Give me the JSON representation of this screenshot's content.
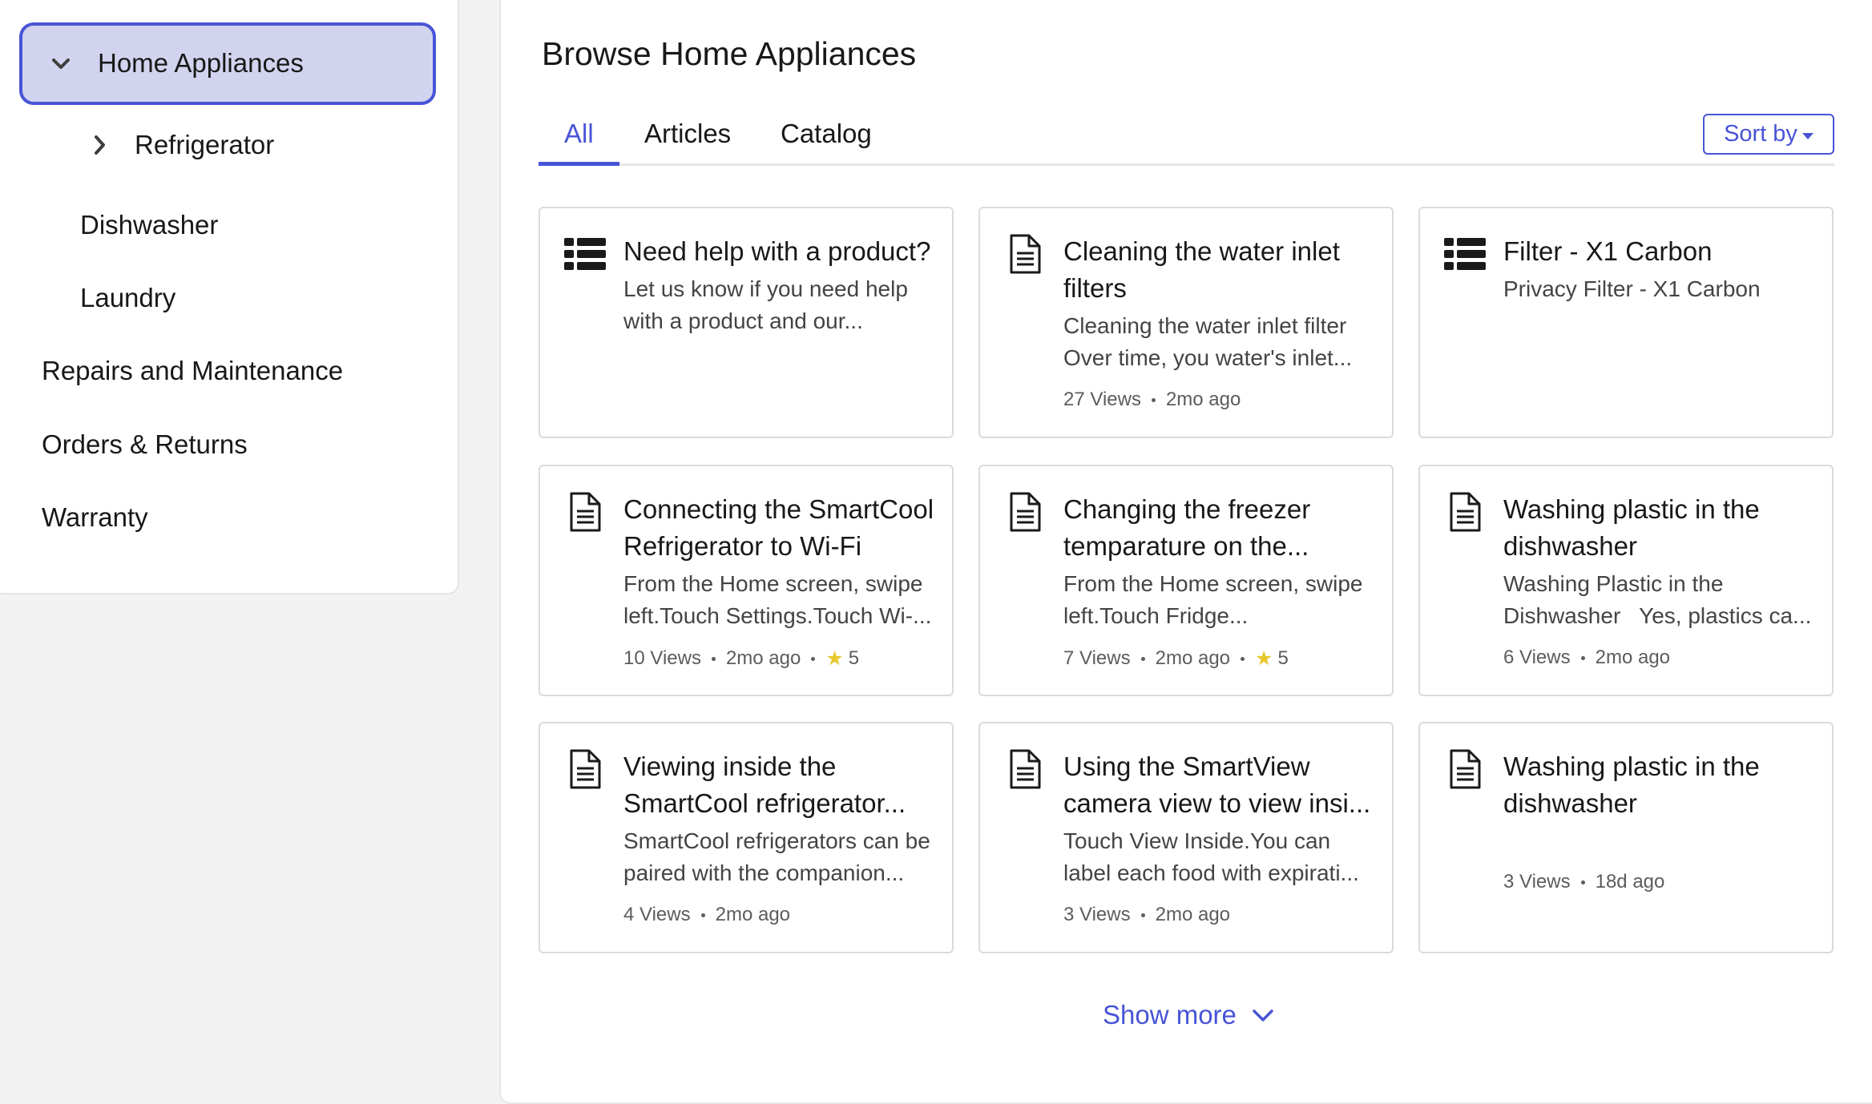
{
  "sidebar": {
    "items": [
      {
        "label": "Home Appliances"
      },
      {
        "label": "Refrigerator"
      },
      {
        "label": "Dishwasher"
      },
      {
        "label": "Laundry"
      },
      {
        "label": "Repairs and Maintenance"
      },
      {
        "label": "Orders & Returns"
      },
      {
        "label": "Warranty"
      }
    ]
  },
  "main": {
    "title": "Browse Home Appliances",
    "tabs": [
      {
        "label": "All",
        "active": true
      },
      {
        "label": "Articles"
      },
      {
        "label": "Catalog"
      }
    ],
    "sort_label": "Sort by",
    "show_more_label": "Show more",
    "cards": [
      {
        "icon": "list-icon",
        "title": "Need help with a product?",
        "description": "Let us know if you need help with a product and our...",
        "views": "",
        "age": "",
        "rating": ""
      },
      {
        "icon": "document-icon",
        "title": "Cleaning the water inlet filters",
        "description": "Cleaning the water inlet filter Over time, you water's inlet...",
        "views": "27 Views",
        "age": "2mo ago",
        "rating": ""
      },
      {
        "icon": "list-icon",
        "title": "Filter - X1 Carbon",
        "description": "Privacy Filter - X1 Carbon",
        "views": "",
        "age": "",
        "rating": ""
      },
      {
        "icon": "document-icon",
        "title": "Connecting the SmartCool Refrigerator to Wi-Fi",
        "description": "From the Home screen, swipe left.Touch Settings.Touch Wi-...",
        "views": "10 Views",
        "age": "2mo ago",
        "rating": "5"
      },
      {
        "icon": "document-icon",
        "title": "Changing the freezer temparature on the...",
        "description": "From the Home screen, swipe left.Touch Fridge...",
        "views": "7 Views",
        "age": "2mo ago",
        "rating": "5"
      },
      {
        "icon": "document-icon",
        "title": "Washing plastic in the dishwasher",
        "description": "Washing Plastic in the Dishwasher   Yes, plastics ca...",
        "views": "6 Views",
        "age": "2mo ago",
        "rating": ""
      },
      {
        "icon": "document-icon",
        "title": "Viewing inside the SmartCool refrigerator...",
        "description": "SmartCool refrigerators can be paired with the companion...",
        "views": "4 Views",
        "age": "2mo ago",
        "rating": ""
      },
      {
        "icon": "document-icon",
        "title": "Using the SmartView camera view to view insi...",
        "description": "Touch View Inside.You can label each food with expirati...",
        "views": "3 Views",
        "age": "2mo ago",
        "rating": ""
      },
      {
        "icon": "document-icon",
        "title": "Washing plastic in the dishwasher",
        "description": "",
        "views": "3 Views",
        "age": "18d ago",
        "rating": ""
      }
    ]
  },
  "colors": {
    "accent": "#4854d6",
    "selected_bg": "#d2d4ef",
    "star": "#e8c72b",
    "page_bg": "#f3f2f2"
  }
}
